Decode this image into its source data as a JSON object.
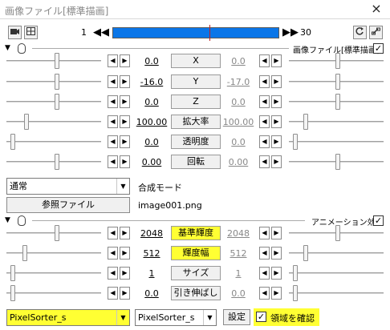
{
  "window": {
    "title": "画像ファイル[標準描画]",
    "close": "×"
  },
  "timeline": {
    "start_frame": "1",
    "end_frame": "30"
  },
  "section1": {
    "title": "画像ファイル[標準描画]",
    "checked": "✓"
  },
  "params1": [
    {
      "label": "X",
      "left_value": "0.0",
      "right_value": "0.0"
    },
    {
      "label": "Y",
      "left_value": "-16.0",
      "right_value": "-17.0"
    },
    {
      "label": "Z",
      "left_value": "0.0",
      "right_value": "0.0"
    },
    {
      "label": "拡大率",
      "left_value": "100.00",
      "right_value": "100.00"
    },
    {
      "label": "透明度",
      "left_value": "0.0",
      "right_value": "0.0"
    },
    {
      "label": "回転",
      "left_value": "0.00",
      "right_value": "0.00"
    }
  ],
  "blend": {
    "value": "通常",
    "label": "合成モード"
  },
  "reference": {
    "button": "参照ファイル",
    "file": "image001.png"
  },
  "section2": {
    "title": "アニメーション効果",
    "checked": "✓"
  },
  "params2": [
    {
      "label": "基準輝度",
      "left_value": "2048",
      "right_value": "2048",
      "highlight": true
    },
    {
      "label": "輝度幅",
      "left_value": "512",
      "right_value": "512",
      "highlight": true
    },
    {
      "label": "サイズ",
      "left_value": "1",
      "right_value": "1",
      "highlight": false
    },
    {
      "label": "引き伸ばし",
      "left_value": "0.0",
      "right_value": "0.0",
      "highlight": false
    }
  ],
  "bottom": {
    "combo1": "PixelSorter_s",
    "combo2": "PixelSorter_s",
    "settings_button": "設定",
    "checkbox_label": "領域を確認",
    "checkbox_mark": "✓"
  },
  "icons": {
    "spin_left": "◀",
    "spin_right": "▶",
    "dropdown": "▼",
    "tri": "▼",
    "rewind": "◀◀",
    "forward": "▶▶"
  },
  "colors": {
    "highlight": "#ffff33",
    "timeline": "#0b76e8"
  }
}
